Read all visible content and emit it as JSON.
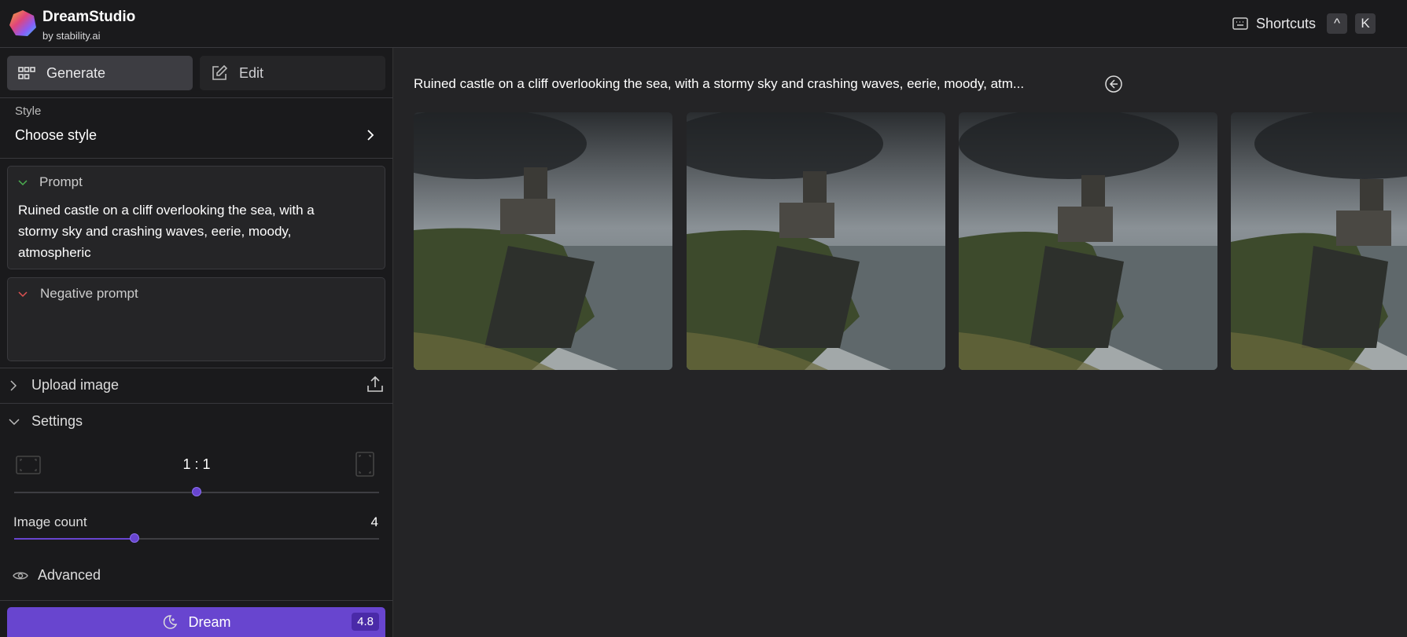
{
  "header": {
    "brand": "DreamStudio",
    "byline": "by stability.ai",
    "shortcuts_label": "Shortcuts",
    "keys": [
      "^",
      "K"
    ]
  },
  "sidebar": {
    "tabs": [
      {
        "label": "Generate",
        "active": true
      },
      {
        "label": "Edit",
        "active": false
      }
    ],
    "style": {
      "label": "Style",
      "value": "Choose style"
    },
    "prompt": {
      "label": "Prompt",
      "value": "Ruined castle on a cliff overlooking the sea, with a stormy sky and crashing waves, eerie, moody, atmospheric"
    },
    "negative_prompt": {
      "label": "Negative prompt",
      "value": ""
    },
    "upload": {
      "label": "Upload image"
    },
    "settings": {
      "label": "Settings",
      "aspect_ratio": "1 : 1",
      "aspect_slider_fraction": 0.5,
      "image_count_label": "Image count",
      "image_count": "4",
      "image_count_fraction": 0.33
    },
    "advanced": {
      "label": "Advanced"
    },
    "dream": {
      "label": "Dream",
      "cost": "4.8"
    }
  },
  "main": {
    "prompt_title": "Ruined castle on a cliff overlooking the sea, with a stormy sky and crashing waves, eerie, moody, atm...",
    "images": [
      "castle-image-1",
      "castle-image-2",
      "castle-image-3",
      "castle-image-4"
    ]
  },
  "colors": {
    "accent": "#6845cf",
    "prompt_chevron": "#4caf50",
    "negative_chevron": "#e05252"
  }
}
